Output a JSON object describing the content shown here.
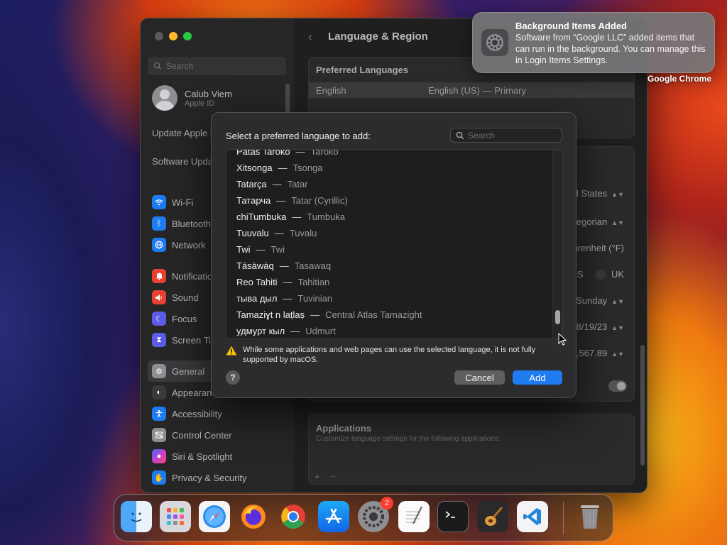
{
  "settings": {
    "sidebar": {
      "search_placeholder": "Search",
      "user_name": "Calub Viem",
      "user_sub": "Apple ID",
      "update_note": "Update Apple ID Settings",
      "software_note": "Software Update Available",
      "items": [
        {
          "label": "Wi-Fi",
          "icon": "wifi-icon",
          "color": "#1d7cf2"
        },
        {
          "label": "Bluetooth",
          "icon": "bluetooth-icon",
          "color": "#1d7cf2"
        },
        {
          "label": "Network",
          "icon": "globe-icon",
          "color": "#1d7cf2"
        },
        {
          "label": "Notifications",
          "icon": "bell-icon",
          "color": "#e94235"
        },
        {
          "label": "Sound",
          "icon": "speaker-icon",
          "color": "#e94235"
        },
        {
          "label": "Focus",
          "icon": "moon-icon",
          "color": "#5e5ce6"
        },
        {
          "label": "Screen Time",
          "icon": "hourglass-icon",
          "color": "#5e5ce6"
        },
        {
          "label": "General",
          "icon": "gear-icon",
          "color": "#8e8e93"
        },
        {
          "label": "Appearance",
          "icon": "appearance-icon",
          "color": "#3a3a3c"
        },
        {
          "label": "Accessibility",
          "icon": "accessibility-icon",
          "color": "#1d7cf2"
        },
        {
          "label": "Control Center",
          "icon": "control-center-icon",
          "color": "#8e8e93"
        },
        {
          "label": "Siri & Spotlight",
          "icon": "siri-icon",
          "color": "#c93fd2"
        },
        {
          "label": "Privacy & Security",
          "icon": "hand-icon",
          "color": "#1d7cf2"
        }
      ]
    },
    "content": {
      "title": "Language & Region",
      "preferred_languages_heading": "Preferred Languages",
      "primary_language": "English",
      "primary_language_detail": "English (US) — Primary",
      "region_value": "United States",
      "calendar_value": "Gregorian",
      "temperature_value": "Fahrenheit (°F)",
      "measurement_us": "US",
      "measurement_uk": "UK",
      "first_day_value": "Sunday",
      "date_format_value": "8/19/23",
      "number_format_value": "1,234,567.89",
      "applications_heading": "Applications",
      "applications_sub": "Customize language settings for the following applications:",
      "plus": "+",
      "minus": "−"
    }
  },
  "dialog": {
    "title": "Select a preferred language to add:",
    "search_placeholder": "Search",
    "languages": [
      {
        "native": "Patas Taroko",
        "english": "Taroko"
      },
      {
        "native": "Xitsonga",
        "english": "Tsonga"
      },
      {
        "native": "Tatarça",
        "english": "Tatar"
      },
      {
        "native": "Татарча",
        "english": "Tatar (Cyrillic)"
      },
      {
        "native": "chiTumbuka",
        "english": "Tumbuka"
      },
      {
        "native": "Tuuvalu",
        "english": "Tuvalu"
      },
      {
        "native": "Twi",
        "english": "Twi"
      },
      {
        "native": "Tásàwàq",
        "english": "Tasawaq"
      },
      {
        "native": "Reo Tahiti",
        "english": "Tahitian"
      },
      {
        "native": "тыва дыл",
        "english": "Tuvinian"
      },
      {
        "native": "Tamaziɣt n laṭlaṣ",
        "english": "Central Atlas Tamazight"
      },
      {
        "native": "удмурт кыл",
        "english": "Udmurt"
      }
    ],
    "warning": "While some applications and web pages can use the selected language, it is not fully supported by macOS.",
    "help_label": "?",
    "cancel_label": "Cancel",
    "add_label": "Add"
  },
  "notification": {
    "title": "Background Items Added",
    "body": "Software from “Google LLC” added items that can run in the background. You can manage this in Login Items Settings.",
    "app_label": "Google Chrome",
    "icon": "system-settings-icon"
  },
  "dock": {
    "items": [
      {
        "name": "finder",
        "icon": "finder-icon"
      },
      {
        "name": "launchpad",
        "icon": "launchpad-icon"
      },
      {
        "name": "safari",
        "icon": "safari-icon"
      },
      {
        "name": "firefox",
        "icon": "firefox-icon"
      },
      {
        "name": "chrome",
        "icon": "chrome-icon"
      },
      {
        "name": "app-store",
        "icon": "app-store-icon"
      },
      {
        "name": "system-settings",
        "icon": "system-settings-icon",
        "badge": "2"
      },
      {
        "name": "textedit",
        "icon": "textedit-icon"
      },
      {
        "name": "terminal",
        "icon": "terminal-icon"
      },
      {
        "name": "garageband",
        "icon": "garageband-icon"
      },
      {
        "name": "vscode",
        "icon": "vscode-icon"
      },
      {
        "name": "trash",
        "icon": "trash-icon"
      }
    ]
  },
  "colors": {
    "accent": "#1f7cf0",
    "warning": "#f5c400",
    "badge": "#ff3b30"
  }
}
